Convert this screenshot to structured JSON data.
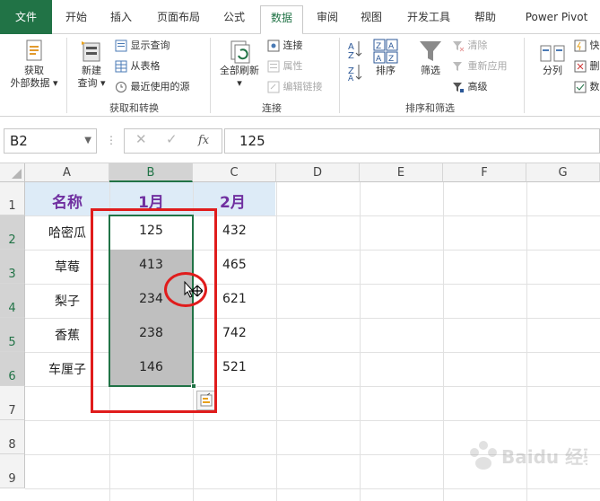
{
  "ribbon_tabs": [
    "文件",
    "开始",
    "插入",
    "页面布局",
    "公式",
    "数据",
    "审阅",
    "视图",
    "开发工具",
    "帮助",
    "Power Pivot"
  ],
  "active_tab": "数据",
  "ribbon": {
    "get_external_data": [
      "获取",
      "外部数据"
    ],
    "new_query": [
      "新建",
      "查询"
    ],
    "show_queries": "显示查询",
    "from_table": "从表格",
    "recent_sources": "最近使用的源",
    "group_get_transform": "获取和转换",
    "refresh_all": "全部刷新",
    "connections": "连接",
    "properties": "属性",
    "edit_links": "编辑链接",
    "group_connections": "连接",
    "sort": "排序",
    "filter": "筛选",
    "clear": "清除",
    "reapply": "重新应用",
    "advanced": "高级",
    "group_sort_filter": "排序和筛选",
    "split_column": "分列",
    "flash_fill": "快",
    "remove_dup": "删",
    "data_validation": "数"
  },
  "formula_bar": {
    "name_box": "B2",
    "formula": "125",
    "cancel_icon": "✕",
    "enter_icon": "✓",
    "fx_icon": "fx"
  },
  "columns": [
    "A",
    "B",
    "C",
    "D",
    "E",
    "F",
    "G"
  ],
  "rows": [
    "1",
    "2",
    "3",
    "4",
    "5",
    "6",
    "7",
    "8",
    "9"
  ],
  "table": {
    "header": [
      "名称",
      "1月",
      "2月"
    ],
    "rows": [
      [
        "哈密瓜",
        "125",
        "432"
      ],
      [
        "草莓",
        "413",
        "465"
      ],
      [
        "梨子",
        "234",
        "621"
      ],
      [
        "香蕉",
        "238",
        "742"
      ],
      [
        "车厘子",
        "146",
        "521"
      ]
    ]
  },
  "colors": {
    "accent": "#217346",
    "header_fill": "#ddebf7",
    "header_text": "#7030a0",
    "selection_fill": "#bfbfbf",
    "annotation": "#e01c1c"
  },
  "watermark": "Baidu 经验"
}
